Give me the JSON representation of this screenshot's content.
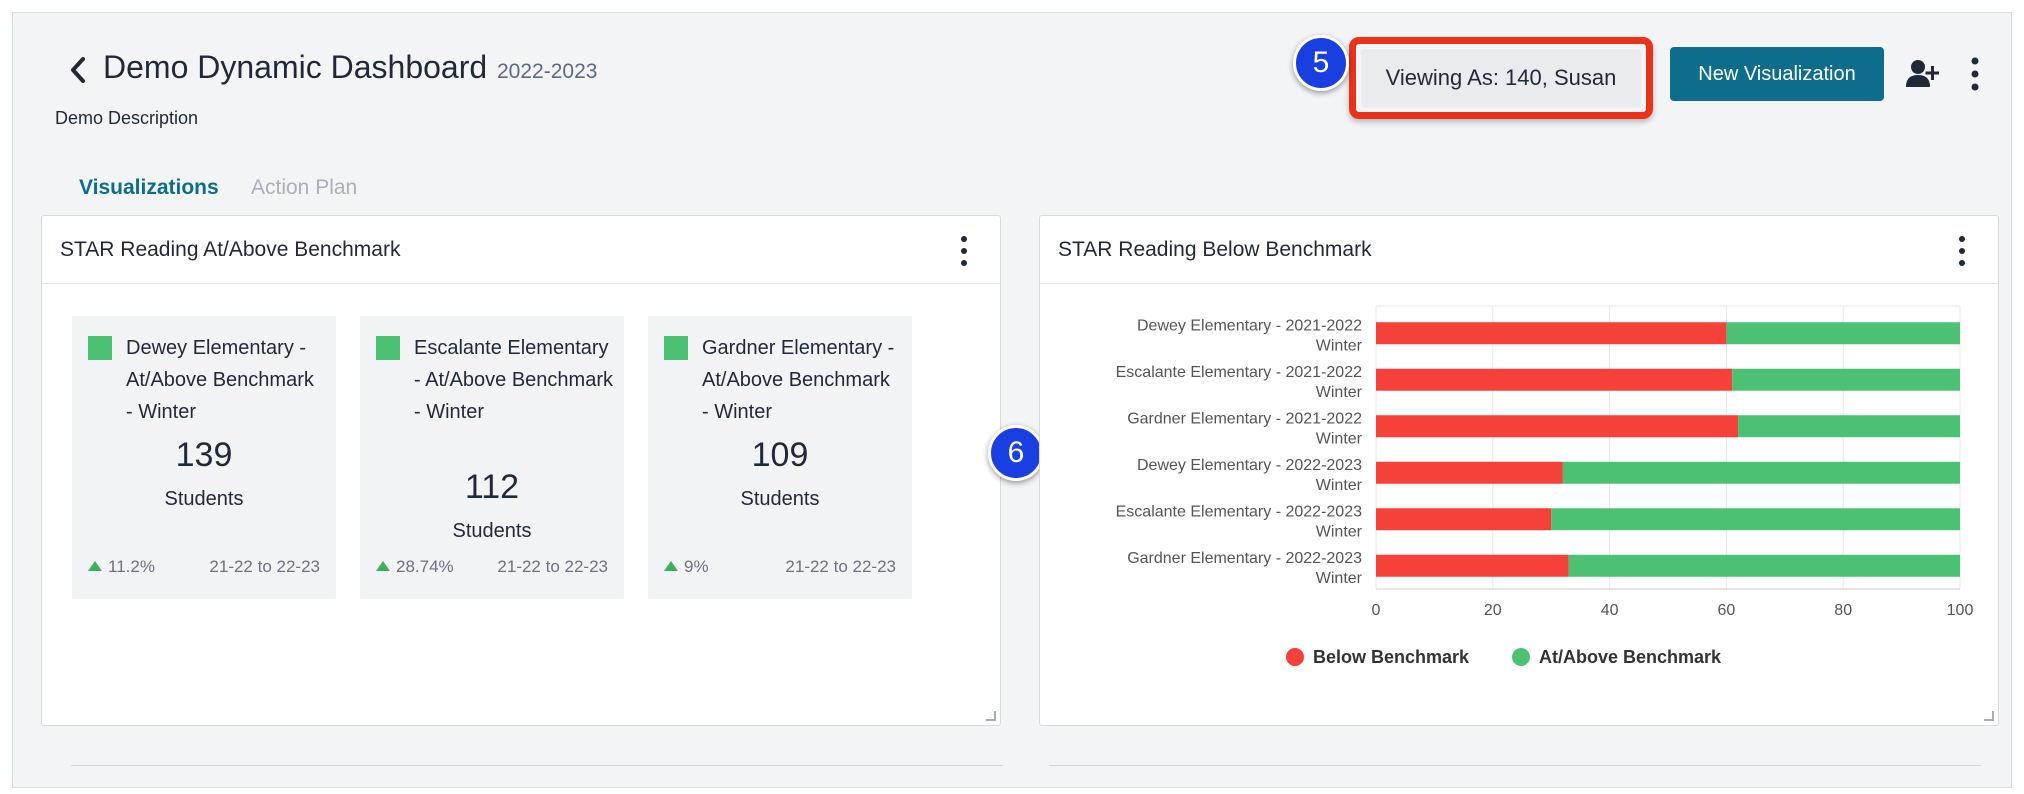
{
  "header": {
    "title": "Demo Dynamic Dashboard",
    "year": "2022-2023",
    "description": "Demo Description",
    "viewing_as": "Viewing As: 140, Susan",
    "new_visualization": "New Visualization"
  },
  "badges": {
    "five": "5",
    "six": "6"
  },
  "tabs": [
    {
      "label": "Visualizations",
      "active": true
    },
    {
      "label": "Action Plan",
      "active": false
    }
  ],
  "cards": {
    "left": {
      "title": "STAR Reading At/Above Benchmark",
      "tiles": [
        {
          "label": "Dewey Elementary - At/Above Benchmark - Winter",
          "value": "139",
          "unit": "Students",
          "change": "11.2%",
          "range": "21-22 to 22-23"
        },
        {
          "label": "Escalante Elementary - At/Above Benchmark - Winter",
          "value": "112",
          "unit": "Students",
          "change": "28.74%",
          "range": "21-22 to 22-23"
        },
        {
          "label": "Gardner Elementary - At/Above Benchmark - Winter",
          "value": "109",
          "unit": "Students",
          "change": "9%",
          "range": "21-22 to 22-23"
        }
      ]
    },
    "right": {
      "title": "STAR Reading Below Benchmark"
    }
  },
  "colors": {
    "accent": "#0f6d8c",
    "highlight": "#e8331a",
    "badge": "#1a3fe0",
    "below": "#f5413a",
    "above": "#4cc174"
  },
  "chart_data": {
    "type": "bar",
    "orientation": "horizontal",
    "stacked": true,
    "title": "STAR Reading Below Benchmark",
    "categories": [
      [
        "Dewey Elementary - 2021-2022",
        "Winter"
      ],
      [
        "Escalante Elementary - 2021-2022",
        "Winter"
      ],
      [
        "Gardner Elementary - 2021-2022",
        "Winter"
      ],
      [
        "Dewey Elementary - 2022-2023",
        "Winter"
      ],
      [
        "Escalante Elementary - 2022-2023",
        "Winter"
      ],
      [
        "Gardner Elementary - 2022-2023",
        "Winter"
      ]
    ],
    "series": [
      {
        "name": "Below Benchmark",
        "color": "#f5413a",
        "values": [
          60,
          61,
          62,
          32,
          30,
          33
        ]
      },
      {
        "name": "At/Above Benchmark",
        "color": "#4cc174",
        "values": [
          40,
          39,
          38,
          68,
          70,
          67
        ]
      }
    ],
    "xlim": [
      0,
      100
    ],
    "xticks": [
      0,
      20,
      40,
      60,
      80,
      100
    ],
    "legend": "bottom",
    "grid": true
  }
}
